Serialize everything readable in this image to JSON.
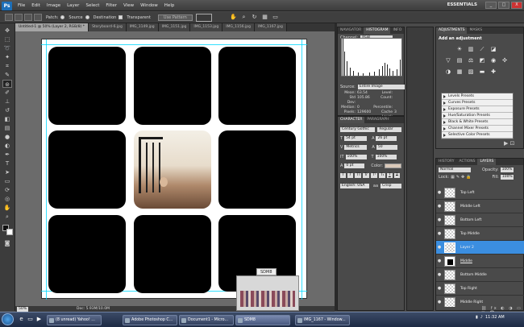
{
  "app": {
    "logo": "Ps",
    "workspace": "ESSENTIALS",
    "window_min": "_",
    "window_max": "□",
    "window_close": "X"
  },
  "menu": [
    "File",
    "Edit",
    "Image",
    "Layer",
    "Select",
    "Filter",
    "View",
    "Window",
    "Help"
  ],
  "options": {
    "patch_label": "Patch:",
    "source": "Source",
    "destination": "Destination",
    "transparent": "Transparent",
    "use_pattern": "Use Pattern"
  },
  "tabs": [
    {
      "label": "Untitled-1 @ 50% (Layer 2, RGB/8) *"
    },
    {
      "label": "Storyboard-6.jpg"
    },
    {
      "label": "IMG_1149.jpg"
    },
    {
      "label": "IMG_1151.jpg"
    },
    {
      "label": "IMG_1153.jpg"
    },
    {
      "label": "IMG_1156.jpg"
    },
    {
      "label": "IMG_1167.jpg"
    }
  ],
  "status": {
    "zoom": "50%",
    "doc": "Doc: 5.93M/10.0M"
  },
  "thumb_popup": {
    "title": "SDM8"
  },
  "navigator": {
    "tabs": [
      "NAVIGATOR",
      "HISTOGRAM",
      "INFO"
    ],
    "channel_label": "Channel:",
    "channel_value": "RGB",
    "source_label": "Source:",
    "source_value": "Entire Image",
    "stats": [
      [
        "Mean:",
        "63.54",
        "Level:",
        ""
      ],
      [
        "Std Dev:",
        "105.86",
        "Count:",
        ""
      ],
      [
        "Median:",
        "0",
        "Percentile:",
        ""
      ],
      [
        "Pixels:",
        "129600",
        "Cache Level:",
        "3"
      ]
    ]
  },
  "character": {
    "tabs": [
      "CHARACTER",
      "PARAGRAPH"
    ],
    "font": "Century Gothic",
    "style": "Regular",
    "size": "54 pt",
    "leading": "26 pt",
    "kerning": "Metrics",
    "tracking": "50",
    "vscale": "100%",
    "hscale": "100%",
    "baseline": "0 pt",
    "color_label": "Color:",
    "lang": "English: USA",
    "aa": "Crisp",
    "styles": [
      "T",
      "T",
      "TT",
      "Tr",
      "T¹",
      "T₁",
      "T",
      "T"
    ]
  },
  "adjustments": {
    "tabs": [
      "ADJUSTMENTS",
      "MASKS"
    ],
    "title": "Add an adjustment",
    "presets": [
      "Levels Presets",
      "Curves Presets",
      "Exposure Presets",
      "Hue/Saturation Presets",
      "Black & White Presets",
      "Channel Mixer Presets",
      "Selective Color Presets"
    ]
  },
  "layers": {
    "tabs": [
      "HISTORY",
      "ACTIONS",
      "LAYERS"
    ],
    "blend": "Normal",
    "opacity_label": "Opacity:",
    "opacity": "100%",
    "lock_label": "Lock:",
    "fill_label": "Fill:",
    "fill": "100%",
    "items": [
      {
        "name": "Top Left",
        "selected": false,
        "thumb": "trans"
      },
      {
        "name": "Middle Left",
        "selected": false,
        "thumb": "trans"
      },
      {
        "name": "Bottom Left",
        "selected": false,
        "thumb": "trans"
      },
      {
        "name": "Top Middle",
        "selected": false,
        "thumb": "trans"
      },
      {
        "name": "Layer 2",
        "selected": true,
        "thumb": "trans"
      },
      {
        "name": "Middle",
        "selected": false,
        "thumb": "blk"
      },
      {
        "name": "Bottom Middle",
        "selected": false,
        "thumb": "trans"
      },
      {
        "name": "Top Right",
        "selected": false,
        "thumb": "trans"
      },
      {
        "name": "Middle Right",
        "selected": false,
        "thumb": "trans"
      }
    ]
  },
  "taskbar": {
    "items": [
      "(8 unread) Yahoo! ...",
      "Adobe Photoshop C...",
      "Document1 - Micro...",
      "SDM8",
      "IMG_1167 - Window..."
    ],
    "clock": "11:32 AM"
  }
}
